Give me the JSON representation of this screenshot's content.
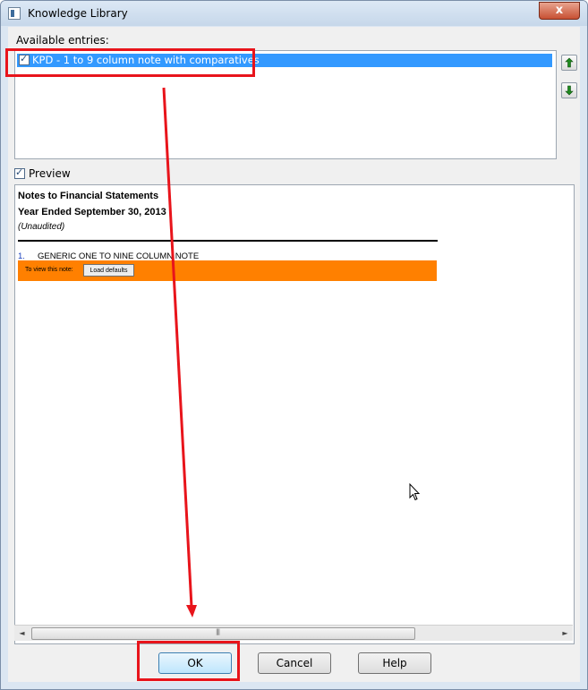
{
  "window": {
    "title": "Knowledge Library",
    "close_label": "x"
  },
  "entries": {
    "label": "Available entries:",
    "items": [
      {
        "label": "KPD - 1 to 9 column note with comparatives",
        "checked": true,
        "selected": true
      }
    ],
    "move_up_icon": "arrow-up-icon",
    "move_down_icon": "arrow-down-icon"
  },
  "preview": {
    "label": "Preview",
    "checked": true,
    "document": {
      "title": "Notes to Financial Statements",
      "period": "Year Ended September 30, 2013",
      "status": "(Unaudited)",
      "note_number": "1.",
      "note_title": "GENERIC ONE TO NINE COLUMN NOTE",
      "bar_text": "To view this note:",
      "load_button": "Load defaults"
    }
  },
  "scrollbar": {
    "left_arrow": "◄",
    "right_arrow": "►",
    "grip": "|||"
  },
  "buttons": {
    "ok": "OK",
    "cancel": "Cancel",
    "help": "Help"
  },
  "colors": {
    "selection": "#3399ff",
    "banner": "#ff8000",
    "annotation": "#e8141b"
  }
}
